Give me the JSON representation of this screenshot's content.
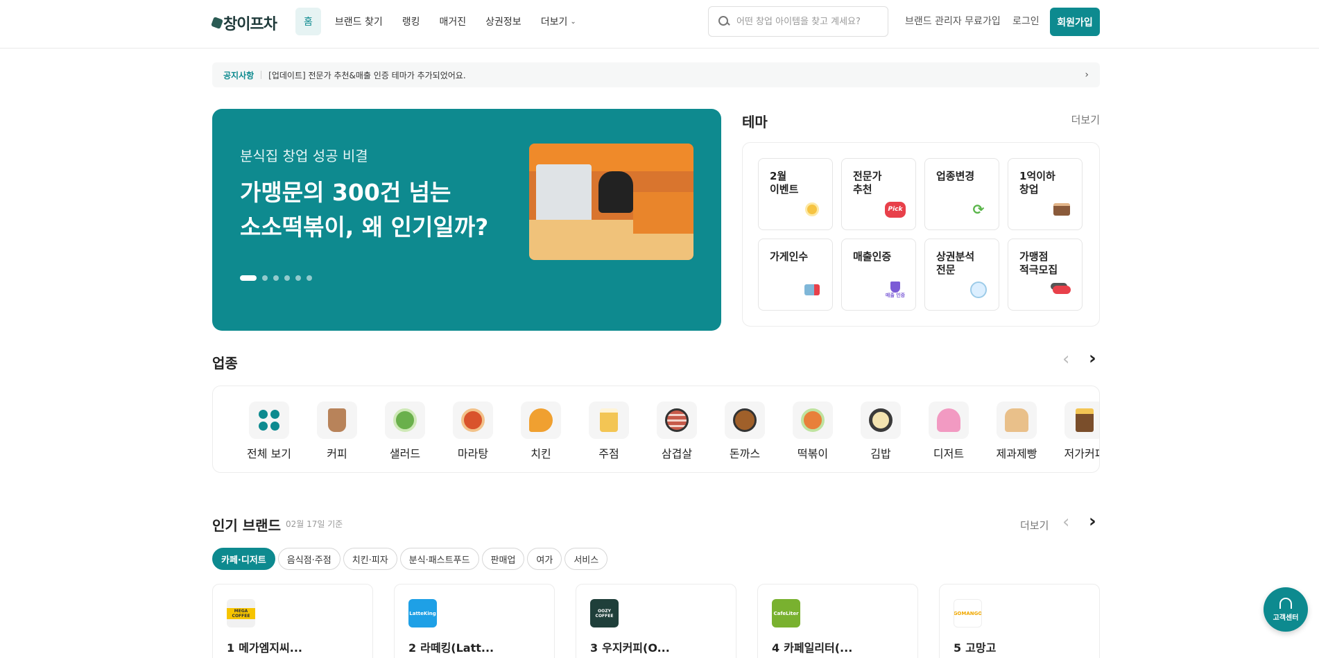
{
  "header": {
    "logo_text": "창이프차",
    "nav": [
      {
        "label": "홈"
      },
      {
        "label": "브랜드 찾기"
      },
      {
        "label": "랭킹"
      },
      {
        "label": "매거진"
      },
      {
        "label": "상권정보"
      },
      {
        "label": "더보기"
      }
    ],
    "search_placeholder": "어떤 창업 아이템을 찾고 계세요?",
    "brand_admin_label": "브랜드 관리자 무료가입",
    "login_label": "로그인",
    "signup_label": "회원가입"
  },
  "notice": {
    "tag": "공지사항",
    "text": "[업데이트] 전문가 추천&매출 인증 테마가 추가되었어요."
  },
  "banner": {
    "subtitle": "분식집 창업 성공 비결",
    "title_line1": "가맹문의 300건 넘는",
    "title_line2": "소소떡볶이, 왜 인기일까?",
    "slide_count": 6,
    "active_slide": 1
  },
  "theme": {
    "title": "테마",
    "more_label": "더보기",
    "cards": [
      {
        "label": "2월\n이벤트",
        "icon": "gift-icon"
      },
      {
        "label": "전문가\n추천",
        "icon": "pick-badge-icon",
        "badge": "Pick"
      },
      {
        "label": "업종변경",
        "icon": "refresh-icon"
      },
      {
        "label": "1억이하\n창업",
        "icon": "wallet-icon"
      },
      {
        "label": "가게인수",
        "icon": "store-icon"
      },
      {
        "label": "매출인증",
        "icon": "shield-check-icon",
        "badge": "매출 인증"
      },
      {
        "label": "상권분석\n전문",
        "icon": "map-icon"
      },
      {
        "label": "가맹점\n적극모집",
        "icon": "recruit-icon"
      }
    ]
  },
  "categories": {
    "title": "업종",
    "items": [
      {
        "label": "전체 보기",
        "color": "#0d8a8f"
      },
      {
        "label": "커피",
        "color": "#b8835a"
      },
      {
        "label": "샐러드",
        "color": "#6ab04c"
      },
      {
        "label": "마라탕",
        "color": "#d9532c"
      },
      {
        "label": "치킨",
        "color": "#f0a030"
      },
      {
        "label": "주점",
        "color": "#f3c554"
      },
      {
        "label": "삼겹살",
        "color": "#c65a4a"
      },
      {
        "label": "돈까스",
        "color": "#a0602a"
      },
      {
        "label": "떡볶이",
        "color": "#e8803a"
      },
      {
        "label": "김밥",
        "color": "#3a3a3a"
      },
      {
        "label": "디저트",
        "color": "#f29ac2"
      },
      {
        "label": "제과제빵",
        "color": "#e9c08a"
      },
      {
        "label": "저가커피",
        "color": "#7a4e2b"
      }
    ]
  },
  "popular": {
    "title": "인기 브랜드",
    "date": "02월 17일 기준",
    "more_label": "더보기",
    "chips": [
      "카페·디저트",
      "음식점·주점",
      "치킨·피자",
      "분식·패스트푸드",
      "판매업",
      "여가",
      "서비스"
    ],
    "brands": [
      {
        "rank": "1",
        "name": "메가엠지씨...",
        "logo_text": "MEGA COFFEE",
        "logo_color": "#f1f1f1"
      },
      {
        "rank": "2",
        "name": "라떼킹(Latt...",
        "logo_text": "LatteKing",
        "logo_color": "#1ea0e6"
      },
      {
        "rank": "3",
        "name": "우지커피(O...",
        "logo_text": "OOZY COFFEE",
        "logo_color": "#1f3f3a"
      },
      {
        "rank": "4",
        "name": "카페일리터(...",
        "logo_text": "CafeLiter",
        "logo_color": "#79b12f"
      },
      {
        "rank": "5",
        "name": "고망고",
        "logo_text": "GOMANGO",
        "logo_color": "#ffffff"
      }
    ]
  },
  "cs": {
    "label": "고객센터"
  }
}
